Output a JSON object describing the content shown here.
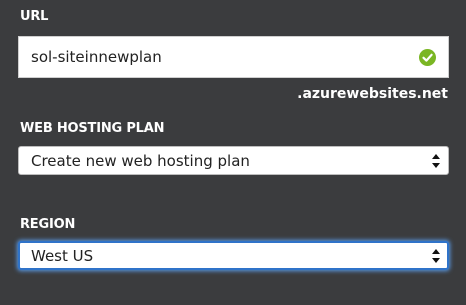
{
  "url": {
    "label": "URL",
    "value": "sol-siteinnewplan",
    "status_icon": "check-circle-icon",
    "status_color": "#7ab623",
    "suffix": ".azurewebsites.net"
  },
  "web_hosting_plan": {
    "label": "WEB HOSTING PLAN",
    "selected": "Create new web hosting plan",
    "icon": "select-arrows-icon"
  },
  "region": {
    "label": "REGION",
    "selected": "West US",
    "icon": "select-arrows-icon",
    "focus_color": "#2f73c9"
  }
}
